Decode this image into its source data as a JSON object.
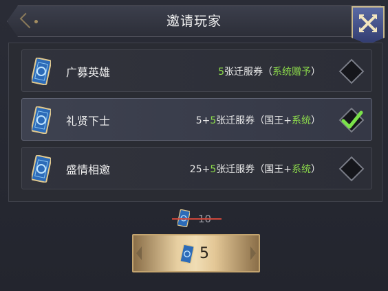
{
  "dialog": {
    "title": "邀请玩家",
    "close_icon": "close-x-icon"
  },
  "options": [
    {
      "name": "广募英雄",
      "desc_parts": [
        {
          "text": "5",
          "color": "green"
        },
        {
          "text": "张迁服券（",
          "color": "white"
        },
        {
          "text": "系统赠予",
          "color": "green"
        },
        {
          "text": "）",
          "color": "white"
        }
      ],
      "selected": false
    },
    {
      "name": "礼贤下士",
      "desc_parts": [
        {
          "text": "5+",
          "color": "white"
        },
        {
          "text": "5",
          "color": "green"
        },
        {
          "text": "张迁服券（国王+",
          "color": "white"
        },
        {
          "text": "系统",
          "color": "green"
        },
        {
          "text": "）",
          "color": "white"
        }
      ],
      "selected": true
    },
    {
      "name": "盛情相邀",
      "desc_parts": [
        {
          "text": "25+",
          "color": "white"
        },
        {
          "text": "5",
          "color": "green"
        },
        {
          "text": "张迁服券（国王+",
          "color": "white"
        },
        {
          "text": "系统",
          "color": "green"
        },
        {
          "text": "）",
          "color": "white"
        }
      ],
      "selected": false
    }
  ],
  "cost": {
    "original": "10",
    "current": "5",
    "icon": "transfer-ticket-icon"
  },
  "colors": {
    "accent_green": "#8ddc4b",
    "strike_red": "#d0473a",
    "button_gold": "#e7cfa1",
    "close_blue": "#4a5a94"
  }
}
